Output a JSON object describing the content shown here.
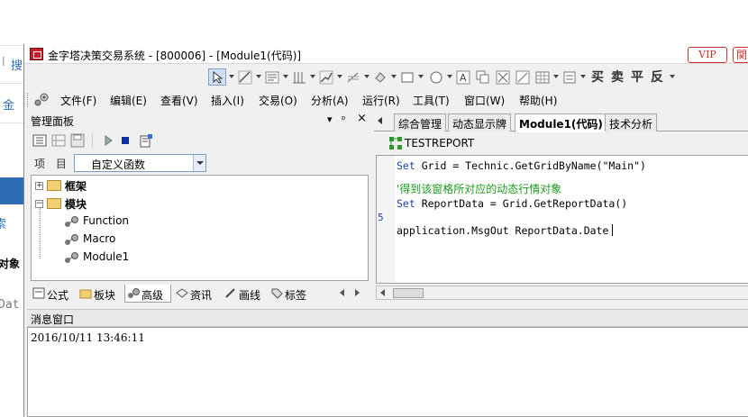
{
  "background_page": {
    "fragments": [
      "l",
      "搜",
      "金",
      "索",
      "对象",
      "Dat"
    ]
  },
  "window": {
    "title": "金字塔决策交易系统 - [800006] - [Module1(代码)]",
    "vip_label": "VIP",
    "close_label": "関",
    "brand_color": "#c8342b"
  },
  "draw_toolbar": {
    "items": [
      "pointer-tool",
      "line-tool",
      "text-tool",
      "bar-tool",
      "trend-tool",
      "fork-tool",
      "fill-tool",
      "rect-tool",
      "ellipse-tool",
      "text-box-tool",
      "copy-tool",
      "delete-tool",
      "grid-tool",
      "settings-tool"
    ],
    "trade_buttons": [
      "买",
      "卖",
      "平",
      "反"
    ]
  },
  "menu": {
    "items": [
      "文件(F)",
      "编辑(E)",
      "查看(V)",
      "插入(I)",
      "交易(O)",
      "分析(A)",
      "运行(R)",
      "工具(T)",
      "窗口(W)",
      "帮助(H)"
    ]
  },
  "left_panel": {
    "title": "管理面板",
    "pin": "▾",
    "dock": "ᵖ",
    "close": "×",
    "project_label": "项 目",
    "project_value": "自定义函数",
    "tree": {
      "framework": "框架",
      "modules": "模块",
      "children": [
        "Function",
        "Macro",
        "Module1"
      ]
    },
    "tabs": [
      "公式",
      "板块",
      "高级",
      "资讯",
      "画线",
      "标签"
    ],
    "active_tab": "高级"
  },
  "editor": {
    "tabs": [
      "综合管理",
      "动态显示牌",
      "Module1(代码)",
      "技术分析"
    ],
    "active_tab": "Module1(代码)",
    "report_name": "TESTREPORT",
    "line_marker": "5",
    "code": {
      "line1_kw": "Set",
      "line1_rest": " Grid = Technic.GetGridByName(\"Main\")",
      "comment": "'得到该窗格所对应的动态行情对象",
      "line3_kw": "Set",
      "line3_rest": " ReportData = Grid.GetReportData()",
      "line5": "application.MsgOut ReportData.Date"
    },
    "keyword_color": "#1b3fa8",
    "comment_color": "#1e9a1e"
  },
  "message_window": {
    "title": "消息窗口",
    "lines": [
      "2016/10/11 13:46:11"
    ]
  }
}
